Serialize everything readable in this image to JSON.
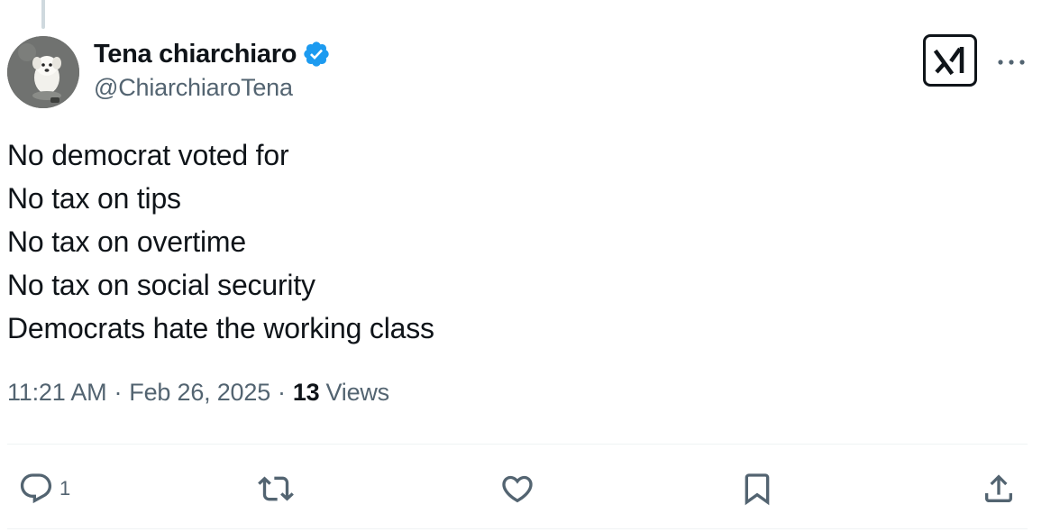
{
  "author": {
    "display_name": "Tena chiarchiaro",
    "handle": "@ChiarchiaroTena",
    "verified": true,
    "verified_color": "#1d9bf0",
    "avatar": "white-dog-avatar"
  },
  "tweet": {
    "lines": [
      "No democrat voted for",
      "No tax on tips",
      "No tax on overtime",
      "No tax on social security",
      "Democrats hate the working class"
    ]
  },
  "meta": {
    "time": "11:21 AM",
    "separator": "·",
    "date": "Feb 26, 2025",
    "views_count": "13",
    "views_label": "Views"
  },
  "header_actions": {
    "grok_icon": "grok-icon",
    "more_icon": "more-icon"
  },
  "actions": {
    "reply": {
      "icon": "reply-icon",
      "count": "1"
    },
    "repost": {
      "icon": "repost-icon"
    },
    "like": {
      "icon": "heart-icon"
    },
    "bookmark": {
      "icon": "bookmark-icon"
    },
    "share": {
      "icon": "share-icon"
    }
  },
  "colors": {
    "text": "#0f1419",
    "secondary": "#536471",
    "divider": "#eff3f4",
    "thread_line": "#cfd9de"
  }
}
